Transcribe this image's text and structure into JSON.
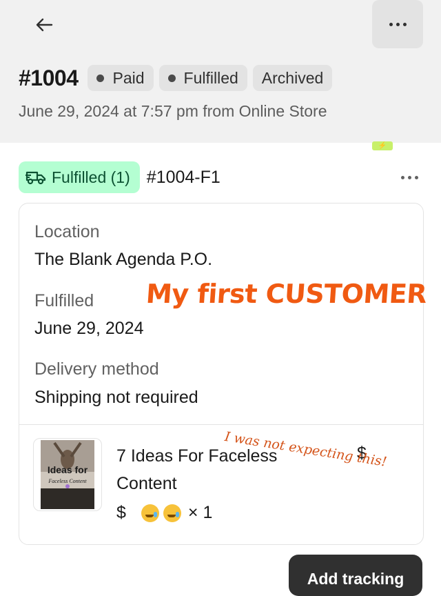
{
  "header": {
    "order_number": "#1004",
    "badges": {
      "paid": "Paid",
      "fulfilled": "Fulfilled",
      "archived": "Archived"
    },
    "meta": "June 29, 2024 at 7:57 pm from Online Store"
  },
  "fulfillment": {
    "status_label": "Fulfilled (1)",
    "fulfillment_id": "#1004-F1"
  },
  "details": {
    "location_label": "Location",
    "location_value": "The Blank Agenda P.O.",
    "fulfilled_label": "Fulfilled",
    "fulfilled_value": "June 29, 2024",
    "delivery_label": "Delivery method",
    "delivery_value": "Shipping not required"
  },
  "product": {
    "name": "7 Ideas For Faceless Content",
    "price_symbol": "$",
    "quantity_text": "× 1",
    "total_symbol": "$",
    "thumb_text": "Ideas for",
    "thumb_sub": "Faceless Content"
  },
  "annotations": {
    "headline": "My first CUSTOMER",
    "note": "I was not expecting this!"
  },
  "actions": {
    "add_tracking": "Add tracking"
  },
  "colors": {
    "header_bg": "#f1f1f1",
    "fulfilled_badge_bg": "#b4fed2",
    "headline_orange": "#f05a12",
    "button_dark": "#303030"
  }
}
